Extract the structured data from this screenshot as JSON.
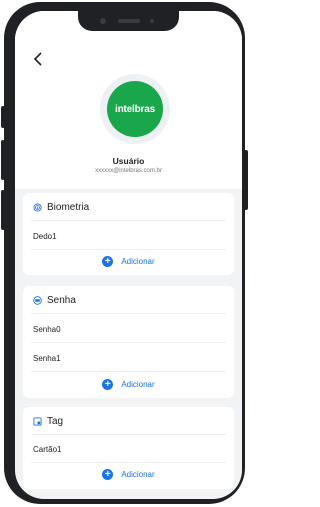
{
  "header": {
    "back_icon": "chevron-left-icon",
    "brand_logo_text": "intelbras",
    "brand_color": "#1aa64a",
    "user_name": "Usuário",
    "user_email": "xxxxxx@intelbras.com.br"
  },
  "accent_color": "#1a73e8",
  "sections": {
    "biometria": {
      "title": "Biometria",
      "icon": "fingerprint-icon",
      "items": [
        "Dedo1"
      ],
      "add_label": "Adicionar"
    },
    "senha": {
      "title": "Senha",
      "icon": "password-icon",
      "items": [
        "Senha0",
        "Senha1"
      ],
      "add_label": "Adicionar"
    },
    "tag": {
      "title": "Tag",
      "icon": "tag-icon",
      "items": [
        "Cartão1"
      ],
      "add_label": "Adicionar"
    }
  }
}
